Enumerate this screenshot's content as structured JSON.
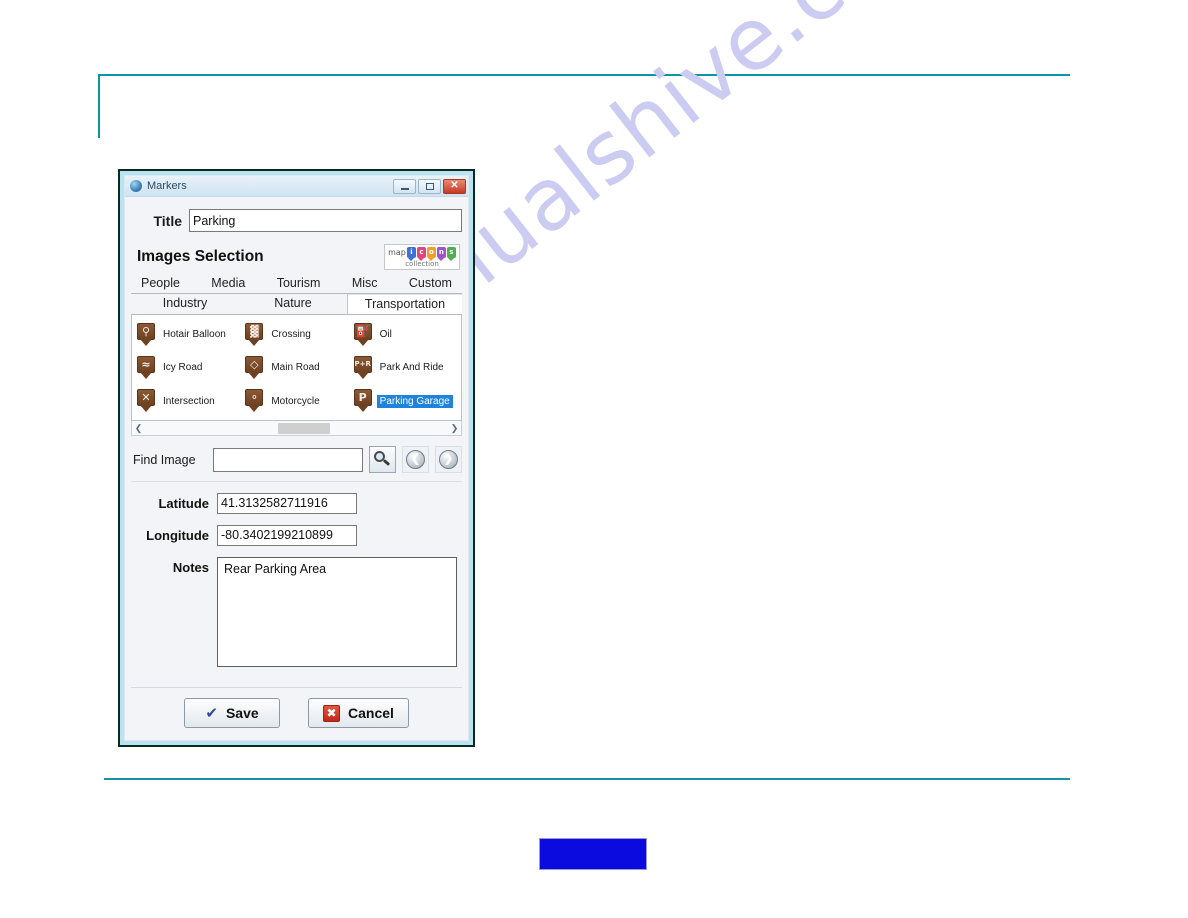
{
  "watermark": "manualshive.com",
  "window": {
    "title": "Markers",
    "app_icon": "globe-icon",
    "buttons": {
      "minimize": "minimize-icon",
      "maximize": "maximize-icon",
      "close": "close-icon"
    }
  },
  "form": {
    "title_label": "Title",
    "title_value": "Parking",
    "title_placeholder": "",
    "images_selection_label": "Images Selection",
    "find_label": "Find Image",
    "find_value": "",
    "find_placeholder": "",
    "latitude_label": "Latitude",
    "latitude_value": "41.3132582711916",
    "longitude_label": "Longitude",
    "longitude_value": "-80.3402199210899",
    "notes_label": "Notes",
    "notes_value": "Rear Parking Area"
  },
  "logo": {
    "prefix": "map",
    "suffix": "collection",
    "letters": [
      {
        "char": "i",
        "color": "#3d6fd4"
      },
      {
        "char": "c",
        "color": "#e0457f"
      },
      {
        "char": "o",
        "color": "#f0a02a"
      },
      {
        "char": "n",
        "color": "#9b55c8"
      },
      {
        "char": "s",
        "color": "#4fae4f"
      }
    ]
  },
  "tabs": {
    "row1": [
      "People",
      "Media",
      "Tourism",
      "Misc",
      "Custom"
    ],
    "row2": [
      "Industry",
      "Nature",
      "Transportation"
    ],
    "active": "Transportation"
  },
  "icon_list": {
    "rows": [
      [
        {
          "label": "Hotair Balloon",
          "glyph": "⚲",
          "selected": false
        },
        {
          "label": "Crossing",
          "glyph": "▓",
          "selected": false
        },
        {
          "label": "Oil",
          "glyph": "⛽",
          "selected": false
        }
      ],
      [
        {
          "label": "Icy Road",
          "glyph": "≈",
          "selected": false
        },
        {
          "label": "Main Road",
          "glyph": "◇",
          "selected": false
        },
        {
          "label": "Park And Ride",
          "glyph": "P+R",
          "selected": false
        }
      ],
      [
        {
          "label": "Intersection",
          "glyph": "✕",
          "selected": false
        },
        {
          "label": "Motorcycle",
          "glyph": "⚬",
          "selected": false
        },
        {
          "label": "Parking Garage",
          "glyph": "P",
          "selected": true
        }
      ]
    ],
    "scroll_left_icon": "chevron-left-icon",
    "scroll_right_icon": "chevron-right-icon"
  },
  "toolbar": {
    "search_icon": "magnifier-icon",
    "back_icon": "arrow-left-icon",
    "forward_icon": "arrow-right-icon",
    "back_glyph": "❮",
    "forward_glyph": "❯"
  },
  "footer": {
    "save_label": "Save",
    "save_icon": "checkmark-icon",
    "save_glyph": "✔",
    "cancel_label": "Cancel",
    "cancel_icon": "x-mark-icon",
    "cancel_glyph": "✖"
  },
  "colors": {
    "rule": "#0b96a6",
    "selection": "#1e83dd",
    "marker": "#6e4122",
    "blue_box": "#0b0be0"
  }
}
